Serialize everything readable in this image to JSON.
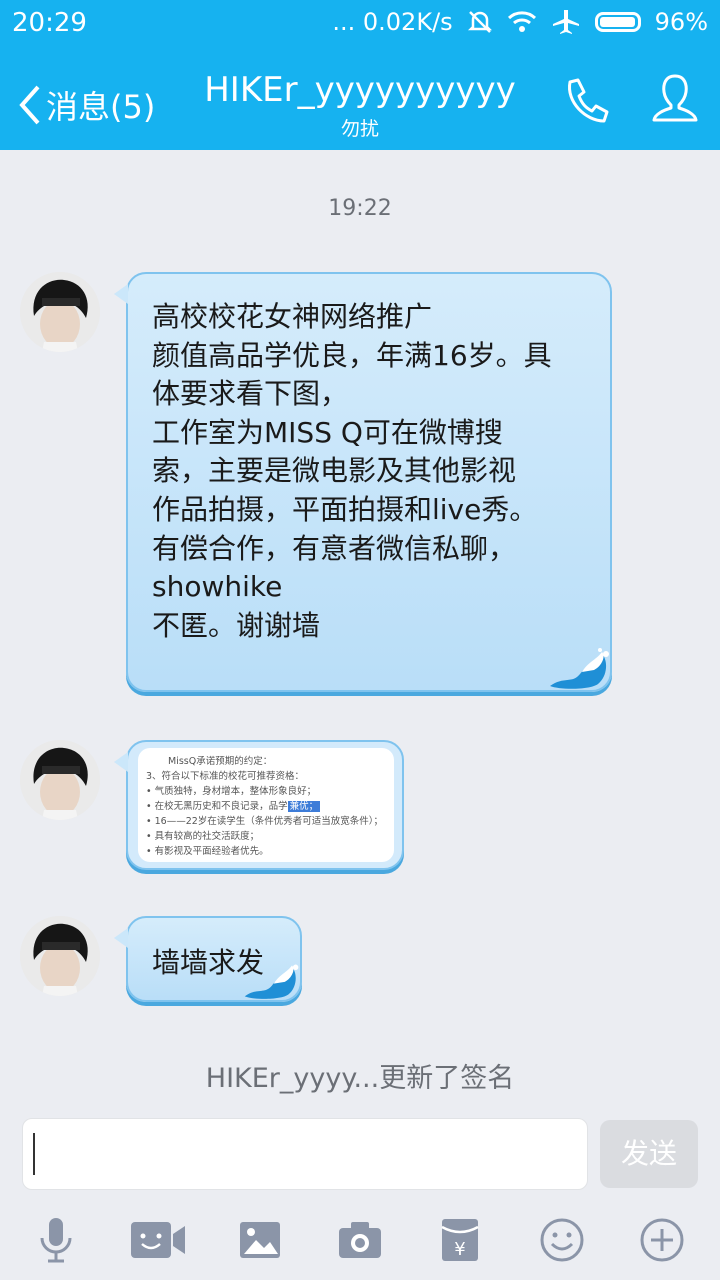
{
  "status_bar": {
    "time": "20:29",
    "network": "... 0.02K/s",
    "battery": "96%"
  },
  "header": {
    "back_label": "消息(5)",
    "title": "HIKEr_yyyyyyyyyy",
    "subtitle": "勿扰"
  },
  "chat": {
    "timestamp": "19:22",
    "message1_lines": [
      "高校校花女神网络推广",
      "颜值高品学优良，年满16岁。具",
      "体要求看下图，",
      "工作室为MISS Q可在微博搜",
      "索，主要是微电影及其他影视",
      "作品拍摄，平面拍摄和live秀。",
      "有偿合作，有意者微信私聊，",
      "showhike",
      "不匿。谢谢墙"
    ],
    "image_lines": [
      "MissQ承诺预期的约定：",
      "3、符合以下标准的校花可推荐资格：",
      "气质独特，身材增本，整体形象良好；",
      "在校无黑历史和不良记录，品学",
      "兼优；",
      "16——22岁在读学生（条件优秀者可适当放宽条件）；",
      "具有较高的社交活跃度；",
      "有影视及平面经验者优先。"
    ],
    "message3": "墙墙求发",
    "signature_notice": "HIKEr_yyyy...更新了签名"
  },
  "composer": {
    "input_value": "",
    "send_label": "发送"
  },
  "colors": {
    "accent": "#16b2f0",
    "bubble": "#bfe1f9",
    "background": "#ebedf2"
  }
}
